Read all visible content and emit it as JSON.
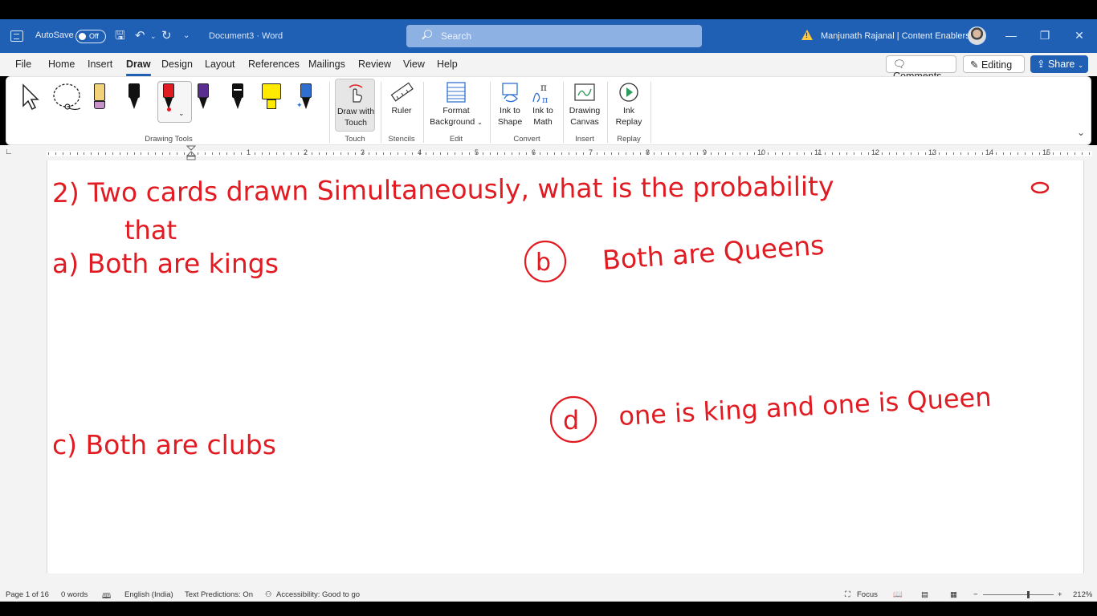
{
  "window": {
    "autosave_label": "AutoSave",
    "autosave_state": "Off",
    "document_title": "Document3",
    "app_name": "Word",
    "search_placeholder": "Search",
    "user_name": "Manjunath Rajanal | Content Enablers"
  },
  "menu": {
    "tabs": [
      "File",
      "Home",
      "Insert",
      "Draw",
      "Design",
      "Layout",
      "References",
      "Mailings",
      "Review",
      "View",
      "Help"
    ],
    "active_tab": "Draw",
    "comments_label": "Comments",
    "editing_label": "Editing",
    "share_label": "Share"
  },
  "ribbon": {
    "groups": {
      "drawing_tools": "Drawing Tools",
      "touch": "Touch",
      "stencils": "Stencils",
      "edit": "Edit",
      "convert": "Convert",
      "insert": "Insert",
      "replay": "Replay"
    },
    "buttons": {
      "draw_with_touch_1": "Draw with",
      "draw_with_touch_2": "Touch",
      "ruler": "Ruler",
      "format_background_1": "Format",
      "format_background_2": "Background",
      "ink_to_shape_1": "Ink to",
      "ink_to_shape_2": "Shape",
      "ink_to_math_1": "Ink to",
      "ink_to_math_2": "Math",
      "drawing_canvas_1": "Drawing",
      "drawing_canvas_2": "Canvas",
      "ink_replay_1": "Ink",
      "ink_replay_2": "Replay"
    }
  },
  "ruler": {
    "numbers": [
      "1",
      "2",
      "3",
      "4",
      "5",
      "6",
      "7",
      "8",
      "9",
      "10",
      "11",
      "12",
      "13",
      "14",
      "15"
    ]
  },
  "ink": {
    "line1": "2) Two cards drawn Simultaneously, what is the probability",
    "line1b": "that",
    "a": "a) Both are kings",
    "b_label": "b",
    "b": "Both are Queens",
    "c": "c) Both are clubs",
    "d_label": "d",
    "d": "one is king and one is Queen"
  },
  "status": {
    "page": "Page 1 of 16",
    "words": "0 words",
    "language": "English (India)",
    "predictions": "Text Predictions: On",
    "accessibility": "Accessibility: Good to go",
    "focus": "Focus",
    "zoom": "212%"
  },
  "colors": {
    "brand": "#1f5fb4",
    "ink": "#e11b22"
  }
}
